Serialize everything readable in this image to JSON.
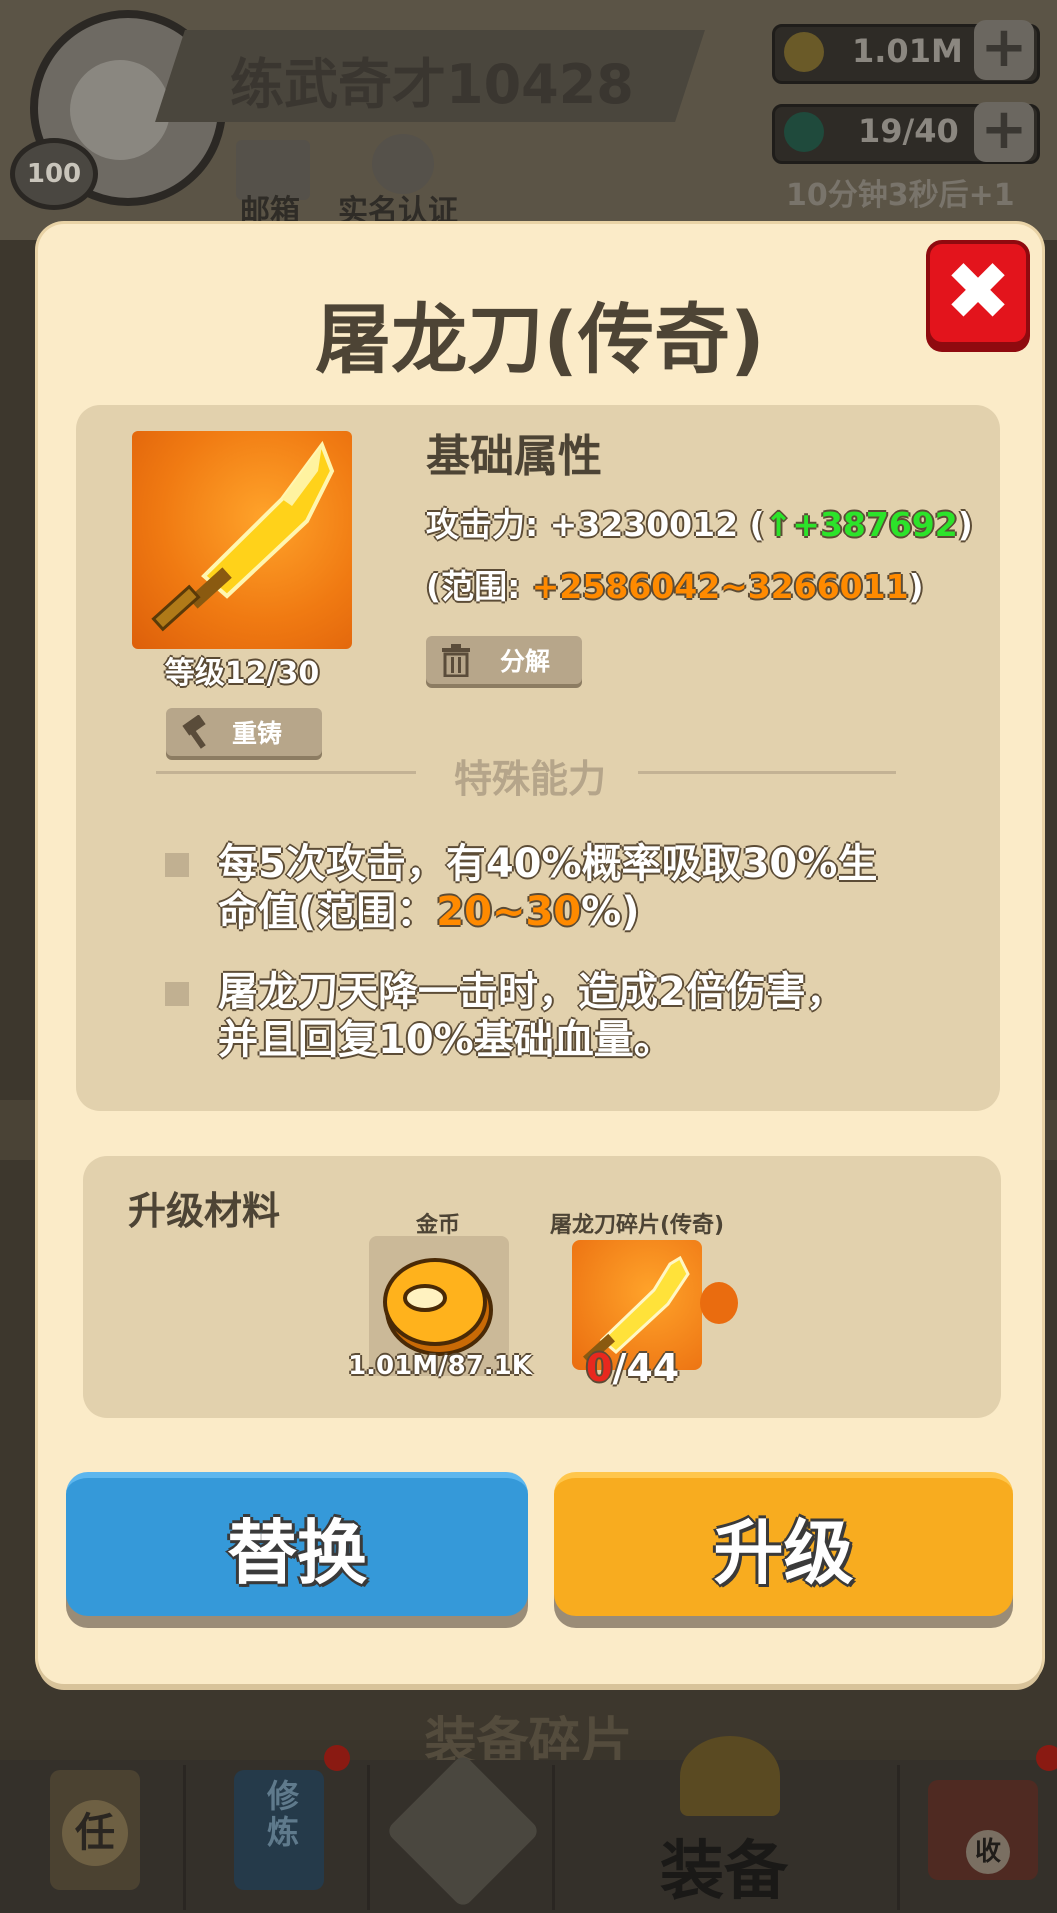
{
  "header": {
    "player_level": "100",
    "player_name": "练武奇才10428",
    "mail_label": "邮箱",
    "verify_label": "实名认证",
    "gold_amount": "1.01M",
    "energy_amount": "19/40",
    "energy_timer": "10分钟3秒后+1",
    "plus": "+"
  },
  "background": {
    "shards_title": "装备碎片"
  },
  "bottom_nav": {
    "task_label": "任",
    "train_label": "修炼",
    "equip_label": "装备",
    "collect_label": "收"
  },
  "modal": {
    "title": "屠龙刀(传奇)",
    "close": "✖",
    "item_level": "等级12/30",
    "reforge_label": "重铸",
    "decompose_label": "分解",
    "attr_title": "基础属性",
    "attack_prefix": "攻击力: +3230012 (",
    "attack_up_arrow": "↑",
    "attack_gain": "+387692",
    "attack_suffix": ")",
    "range_prefix": "(范围: ",
    "range_value": "+2586042~3266011",
    "range_suffix": ")",
    "special_title": "特殊能力",
    "ability1_line1": "每5次攻击，有40%概率吸取30%生",
    "ability1_line2_prefix": "命值(范围：",
    "ability1_line2_value": "20~30",
    "ability1_line2_suffix": "%)",
    "ability2_line1": "屠龙刀天降一击时，造成2倍伤害，",
    "ability2_line2": "并且回复10%基础血量。",
    "materials_title": "升级材料",
    "mat_gold_label": "金币",
    "mat_gold_count": "1.01M/87.1K",
    "mat_shard_label": "屠龙刀碎片(传奇)",
    "mat_shard_have": "0",
    "mat_shard_need": "/44",
    "replace_label": "替换",
    "upgrade_label": "升级"
  },
  "colors": {
    "modal_bg": "#fbebc8",
    "panel_bg": "#e2d1ad",
    "replace_btn": "#3599d9",
    "upgrade_btn": "#f8ac1f",
    "close_btn": "#e3141c",
    "gain_green": "#2ce32a",
    "range_orange": "#ff8a00"
  },
  "icons": [
    "avatar",
    "mail-icon",
    "verify-icon",
    "gold-coin-icon",
    "energy-drop-icon",
    "sword-icon",
    "hammer-icon",
    "trash-icon",
    "shard-icon"
  ]
}
